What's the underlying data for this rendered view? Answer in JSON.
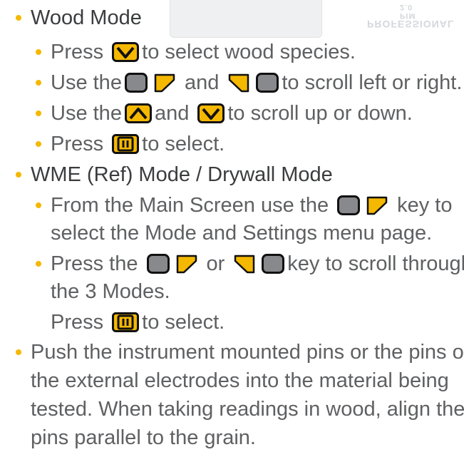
{
  "device": {
    "small_text": "PIM 2.0",
    "label": "PROFESSIONAL"
  },
  "colors": {
    "bullet": "#F5B800",
    "key_fill": "#F5B800",
    "key_gray": "#88898C",
    "key_outline": "#111111",
    "text": "#5F6062",
    "heading": "#3B3C3E"
  },
  "section1": {
    "title": "Wood Mode",
    "line1": {
      "before": "Press",
      "after": "to select wood species."
    },
    "line2": {
      "before": "Use the",
      "mid": "and",
      "after": "to scroll left or right."
    },
    "line3": {
      "before": "Use the",
      "mid": "and",
      "after": "to scroll up or down."
    },
    "line4": {
      "before": "Press",
      "after": "to select."
    }
  },
  "section2": {
    "title": "WME (Ref) Mode / Drywall Mode",
    "line1": {
      "before": "From the Main Screen use the",
      "after": "key to"
    },
    "line1b": "select the Mode and Settings menu page.",
    "line2": {
      "before": "Press the",
      "mid": "or",
      "after": "key to scroll through"
    },
    "line2b": "the 3 Modes.",
    "line3": {
      "before": "Press",
      "after": "to select."
    }
  },
  "section3": {
    "line1": "Push the instrument mounted pins or the pins on",
    "line2": "the external electrodes into the material being",
    "line3": "tested. When taking readings in wood, align the",
    "line4": "pins parallel to the grain."
  },
  "icons": [
    "down-key-icon",
    "left-key-icon",
    "right-key-icon",
    "up-key-icon",
    "select-key-icon"
  ]
}
